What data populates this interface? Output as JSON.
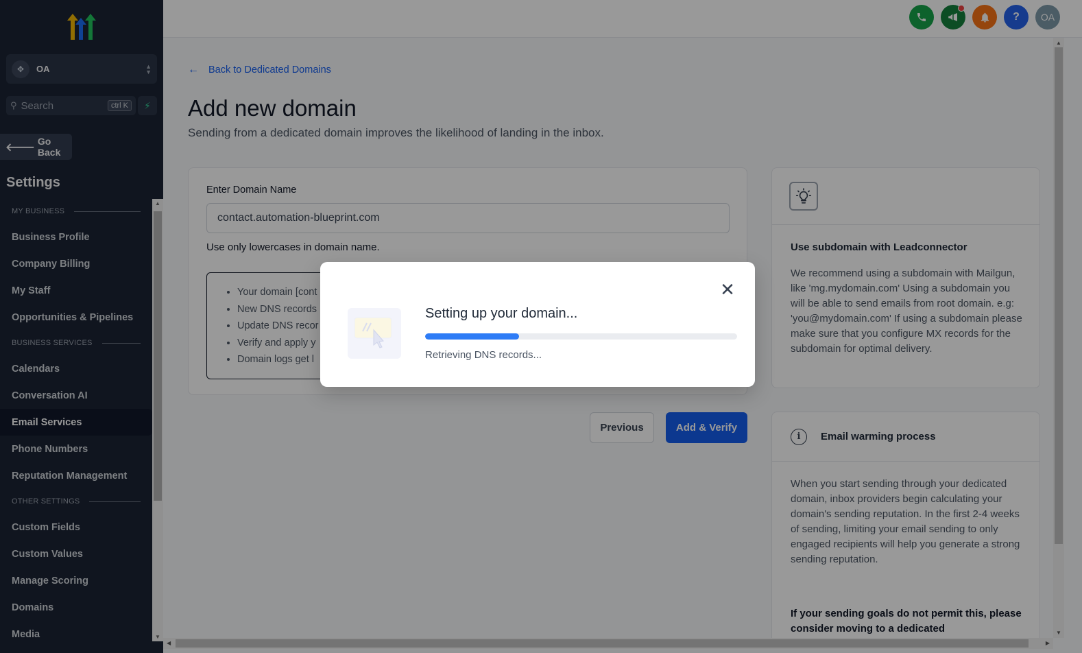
{
  "sidebar": {
    "account_name": "OA",
    "search_placeholder": "Search",
    "search_shortcut": "ctrl K",
    "go_back": "Go Back",
    "settings_title": "Settings",
    "sections": [
      {
        "title": "MY BUSINESS",
        "items": [
          "Business Profile",
          "Company Billing",
          "My Staff",
          "Opportunities & Pipelines"
        ]
      },
      {
        "title": "BUSINESS SERVICES",
        "items": [
          "Calendars",
          "Conversation AI",
          "Email Services",
          "Phone Numbers",
          "Reputation Management"
        ]
      },
      {
        "title": "OTHER SETTINGS",
        "items": [
          "Custom Fields",
          "Custom Values",
          "Manage Scoring",
          "Domains",
          "Media"
        ]
      }
    ],
    "active_item": "Email Services"
  },
  "header": {
    "avatar_initials": "OA",
    "help_label": "?",
    "colors": {
      "phone": "#16a34a",
      "megaphone": "#15803d",
      "bell": "#f97316",
      "help": "#2563eb",
      "avatar": "#7d9aa8"
    }
  },
  "main": {
    "back_link": "Back to Dedicated Domains",
    "title": "Add new domain",
    "subtitle": "Sending from a dedicated domain improves the likelihood of landing in the inbox.",
    "domain_label": "Enter Domain Name",
    "domain_value": "contact.automation-blueprint.com",
    "domain_hint": "Use only lowercases in domain name.",
    "steps": [
      "Your domain [cont",
      "New DNS records",
      "Update DNS recor",
      "Verify and apply y",
      "Domain logs get l"
    ],
    "previous_button": "Previous",
    "add_verify_button": "Add & Verify"
  },
  "tip": {
    "title": "Use subdomain with Leadconnector",
    "body": "We recommend using a subdomain with Mailgun, like 'mg.mydomain.com' Using a subdomain you will be able to send emails from root domain. e.g: 'you@mydomain.com' If using a subdomain please make sure that you configure MX records for the subdomain for optimal delivery."
  },
  "warming": {
    "title": "Email warming process",
    "body": "When you start sending through your dedicated domain, inbox providers begin calculating your domain's sending reputation. In the first 2-4 weeks of sending, limiting your email sending to only engaged recipients will help you generate a strong sending reputation.",
    "bold_note": "If your sending goals do not permit this, please consider moving to a dedicated"
  },
  "modal": {
    "title": "Setting up your domain...",
    "status": "Retrieving DNS records...",
    "progress_percent": 30,
    "accent": "#2e7cf6"
  }
}
